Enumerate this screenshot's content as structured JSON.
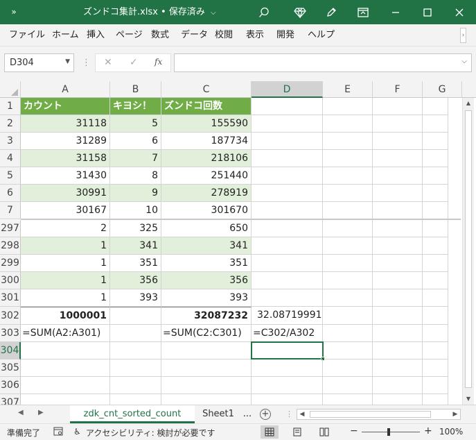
{
  "window": {
    "title": "ズンドコ集計.xlsx • 保存済み",
    "quick_access": "»",
    "title_dropdown": "⌵"
  },
  "ribbon": {
    "tabs": [
      "ファイル",
      "ホーム",
      "挿入",
      "ページ",
      "数式",
      "データ",
      "校閲",
      "表示",
      "開発",
      "ヘルプ"
    ]
  },
  "formula_bar": {
    "name_box": "D304",
    "cancel": "✕",
    "enter": "✓",
    "fx": "fx",
    "content": ""
  },
  "grid": {
    "columns": [
      "A",
      "B",
      "C",
      "D",
      "E",
      "F",
      "G"
    ],
    "selected_column": "D",
    "selected_row": "304",
    "rows": [
      {
        "row": "1",
        "a": "カウント",
        "b": "キヨシ！",
        "c": "ズンドコ回数",
        "d": "",
        "style": "header"
      },
      {
        "row": "2",
        "a": "31118",
        "b": "5",
        "c": "155590",
        "d": "",
        "style": "band"
      },
      {
        "row": "3",
        "a": "31289",
        "b": "6",
        "c": "187734",
        "d": "",
        "style": "plain"
      },
      {
        "row": "4",
        "a": "31158",
        "b": "7",
        "c": "218106",
        "d": "",
        "style": "band"
      },
      {
        "row": "5",
        "a": "31430",
        "b": "8",
        "c": "251440",
        "d": "",
        "style": "plain"
      },
      {
        "row": "6",
        "a": "30991",
        "b": "9",
        "c": "278919",
        "d": "",
        "style": "band"
      },
      {
        "row": "7",
        "a": "30167",
        "b": "10",
        "c": "301670",
        "d": "",
        "style": "plain"
      },
      {
        "row": "297",
        "a": "2",
        "b": "325",
        "c": "650",
        "d": "",
        "style": "plain"
      },
      {
        "row": "298",
        "a": "1",
        "b": "341",
        "c": "341",
        "d": "",
        "style": "band"
      },
      {
        "row": "299",
        "a": "1",
        "b": "351",
        "c": "351",
        "d": "",
        "style": "plain"
      },
      {
        "row": "300",
        "a": "1",
        "b": "356",
        "c": "356",
        "d": "",
        "style": "band"
      },
      {
        "row": "301",
        "a": "1",
        "b": "393",
        "c": "393",
        "d": "",
        "style": "plain"
      },
      {
        "row": "302",
        "a": "1000001",
        "b": "",
        "c": "32087232",
        "d": "32.08719991",
        "style": "total"
      },
      {
        "row": "303",
        "a": "=SUM(A2:A301)",
        "b": "",
        "c": "=SUM(C2:C301)",
        "d": "=C302/A302",
        "style": "formula"
      },
      {
        "row": "304",
        "a": "",
        "b": "",
        "c": "",
        "d": "",
        "style": "empty"
      },
      {
        "row": "305",
        "a": "",
        "b": "",
        "c": "",
        "d": "",
        "style": "empty"
      },
      {
        "row": "306",
        "a": "",
        "b": "",
        "c": "",
        "d": "",
        "style": "empty"
      },
      {
        "row": "307",
        "a": "",
        "b": "",
        "c": "",
        "d": "",
        "style": "empty"
      }
    ]
  },
  "sheets": {
    "tabs": [
      "zdk_cnt_sorted_count",
      "Sheet1"
    ],
    "active": "zdk_cnt_sorted_count",
    "more": "...",
    "add": "+"
  },
  "status": {
    "ready": "準備完了",
    "accessibility": "アクセシビリティ: 検討が必要です",
    "zoom_minus": "−",
    "zoom_plus": "+",
    "zoom": "100%",
    "zoom_percent": 100
  },
  "colors": {
    "excel_green": "#217346",
    "table_header": "#70ad47",
    "table_band": "#e2efda"
  }
}
